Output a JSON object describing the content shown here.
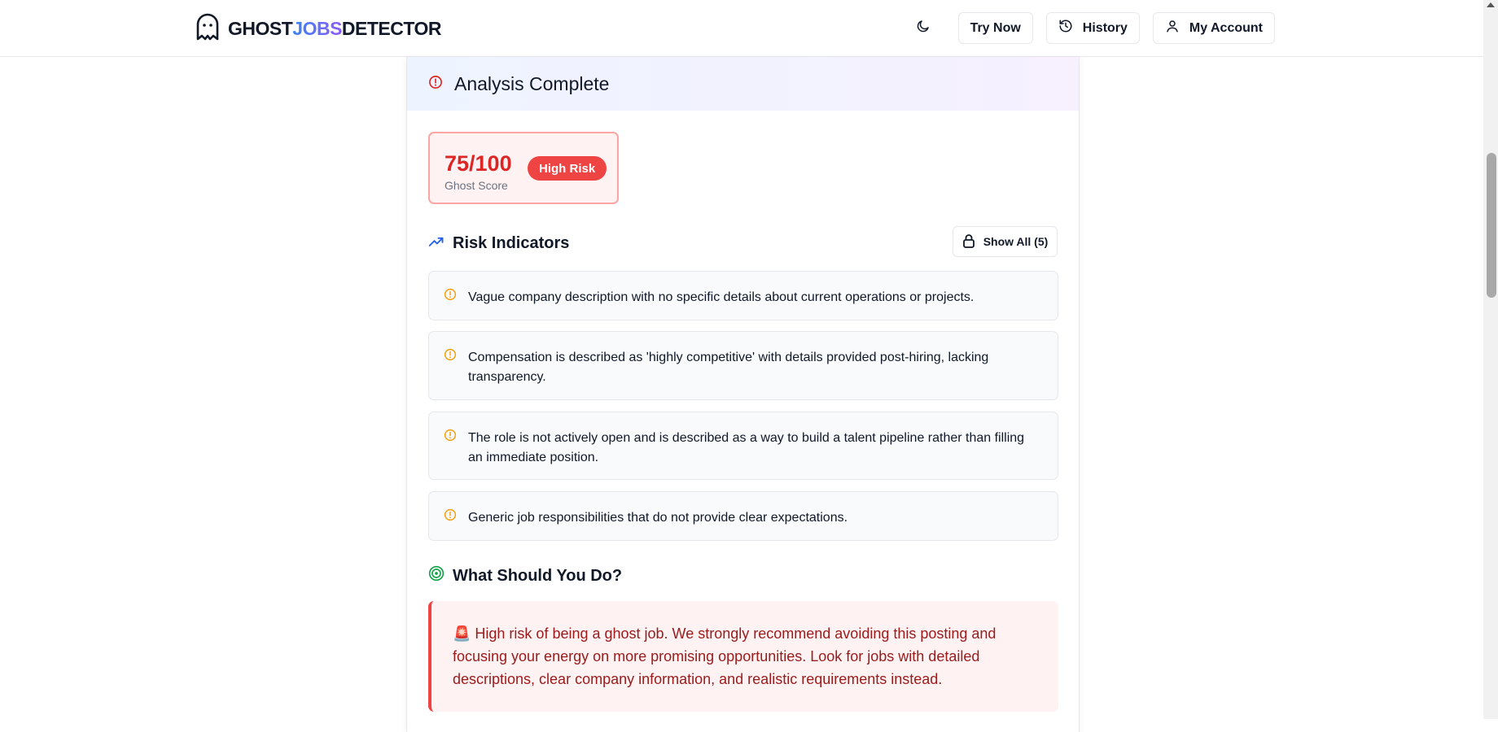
{
  "header": {
    "logo_part1": "GHOST",
    "logo_part2": "JOBS",
    "logo_part3": "DETECTOR",
    "nav": {
      "try_now": "Try Now",
      "history": "History",
      "my_account": "My Account"
    }
  },
  "analysis": {
    "title": "Analysis Complete",
    "score": "75/100",
    "score_label": "Ghost Score",
    "risk_badge": "High Risk"
  },
  "risk_indicators": {
    "title": "Risk Indicators",
    "show_all": "Show All (5)",
    "items": [
      "Vague company description with no specific details about current operations or projects.",
      "Compensation is described as 'highly competitive' with details provided post-hiring, lacking transparency.",
      "The role is not actively open and is described as a way to build a talent pipeline rather than filling an immediate position.",
      "Generic job responsibilities that do not provide clear expectations."
    ]
  },
  "what_to_do": {
    "title": "What Should You Do?",
    "advice": "🚨 High risk of being a ghost job. We strongly recommend avoiding this posting and focusing your energy on more promising opportunities. Look for jobs with detailed descriptions, clear company information, and realistic requirements instead."
  },
  "colors": {
    "danger": "#ef4444",
    "warning": "#f59e0b",
    "accent_blue": "#3b82f6",
    "accent_green": "#16a34a"
  },
  "icons": [
    "ghost-icon",
    "moon-icon",
    "history-icon",
    "user-icon",
    "alert-circle-icon",
    "trending-up-icon",
    "lock-icon",
    "target-icon"
  ]
}
